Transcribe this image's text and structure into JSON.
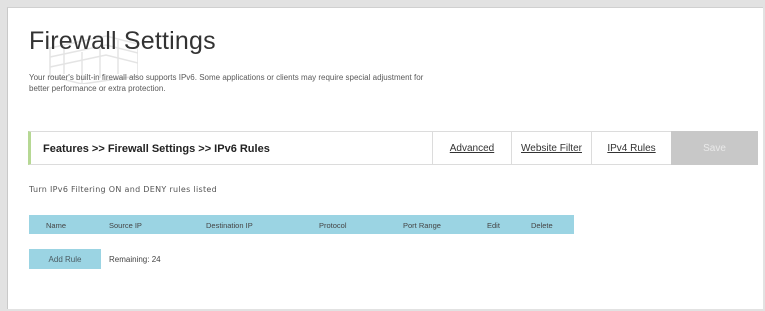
{
  "page": {
    "title": "Firewall Settings",
    "description": "Your router's built-in firewall also supports IPv6. Some applications or clients may require special adjustment for better performance or extra protection."
  },
  "nav": {
    "breadcrumb": "Features >> Firewall Settings >> IPv6 Rules",
    "tabs": [
      "Advanced",
      "Website Filter",
      "IPv4 Rules"
    ],
    "save_label": "Save"
  },
  "rules": {
    "hint": "Turn IPv6 Filtering ON and DENY rules listed",
    "columns": [
      "Name",
      "Source IP",
      "Destination IP",
      "Protocol",
      "Port Range",
      "Edit",
      "Delete"
    ],
    "add_label": "Add Rule",
    "remaining": "Remaining: 24"
  },
  "colors": {
    "accent_blue": "#9bd4e3",
    "accent_green": "#b6d894",
    "save_disabled": "#c8c8c8"
  },
  "icons": [
    "firewall-brick-icon"
  ]
}
